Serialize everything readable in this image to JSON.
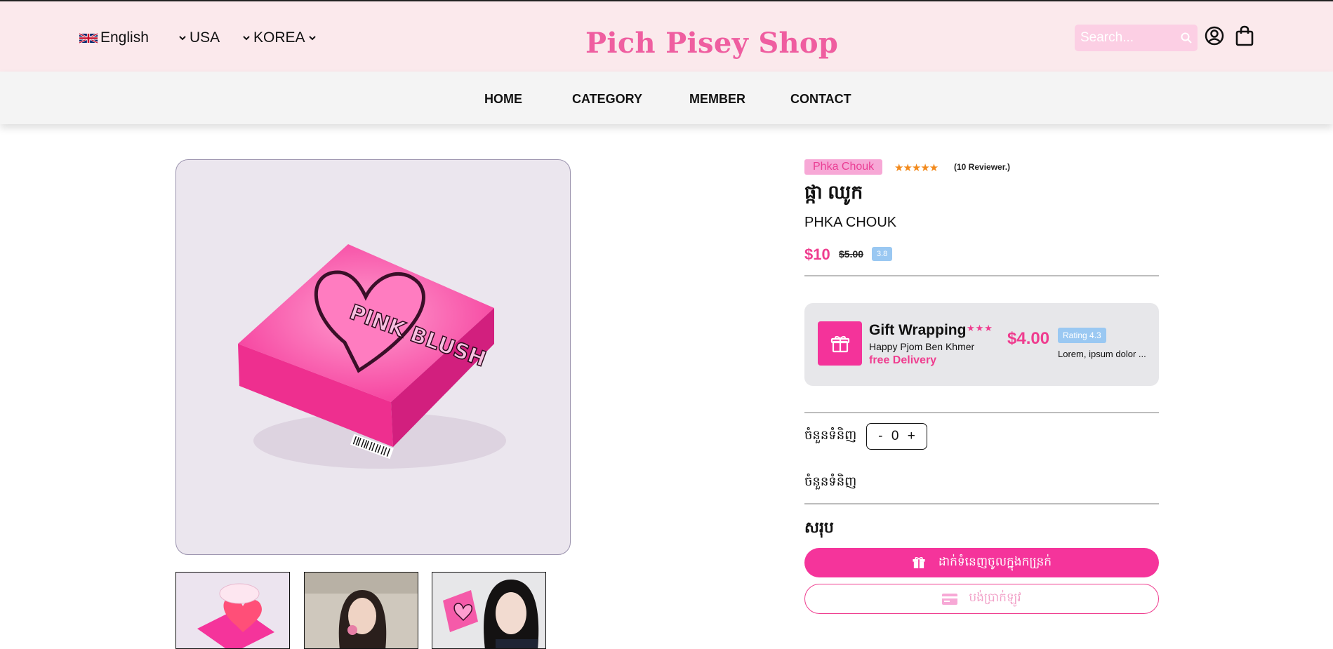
{
  "header": {
    "language": "English",
    "region": "USA",
    "origin": "KOREA",
    "logo": "Pich Pisey Shop",
    "search_placeholder": "Search..."
  },
  "nav": {
    "items": [
      "HOME",
      "CATEGORY",
      "MEMBER",
      "CONTACT"
    ]
  },
  "product": {
    "brand": "Phka Chouk",
    "stars": "★★★★★",
    "reviewers": "(10 Reviewer.)",
    "title_km": "ផ្កា ឈូក",
    "title_en": "PHKA CHOUK",
    "price": "$10",
    "old_price": "$5.00",
    "discount_badge": "3.8",
    "main_image_text": "PINK BLUSH"
  },
  "gift": {
    "title": "Gift Wrapping",
    "stars": "★★★",
    "subtitle": "Happy Pjom Ben Khmer",
    "free_label": "free Delivery",
    "price": "$4.00",
    "rating": "Rating 4.3",
    "description": "Lorem, ipsum dolor ..."
  },
  "quantity": {
    "label": "ចំនួនទំនិញ",
    "minus": "-",
    "value": "0",
    "plus": "+",
    "label2": "ចំនួនទំនិញ"
  },
  "summary": {
    "label": "សរុប"
  },
  "actions": {
    "add_to_cart": "ដាក់ទំនេញចូលក្នុងកន្រ្រក់",
    "pay": "បង់ប្រាក់ឡូវ"
  },
  "colors": {
    "accent": "#f5349b",
    "logo": "#ef5ea0",
    "topbar_bg": "#fbe9ec",
    "nav_bg": "#f4f4f4",
    "badge_blue": "#9ac8f2"
  }
}
